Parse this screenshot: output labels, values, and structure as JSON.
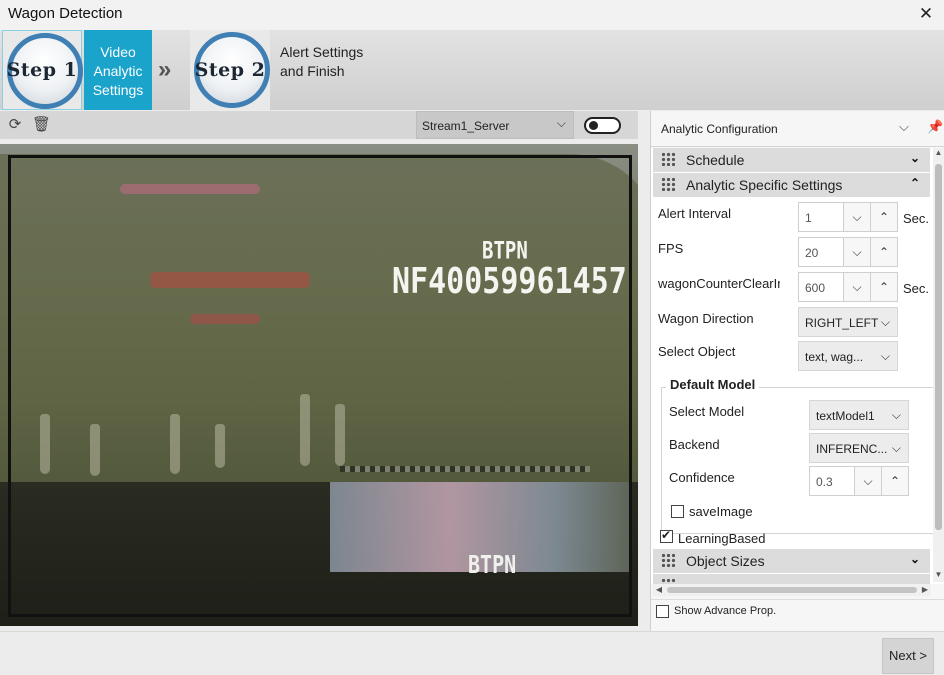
{
  "window": {
    "title": "Wagon Detection",
    "close_glyph": "✕"
  },
  "steps": [
    {
      "badge": "Step 1",
      "label": "Video Analytic Settings",
      "active": true
    },
    {
      "badge": "Step 2",
      "label": "Alert Settings and Finish",
      "active": false
    }
  ],
  "step_separator": "»",
  "video": {
    "toolbar": {
      "refresh_icon": "refresh-icon",
      "delete_icon": "trash-icon"
    },
    "stream": "Stream1_Server",
    "toggle_on": false,
    "frame_text": {
      "plate_small": "BTPN",
      "plate_main": "NF40059961457",
      "plate_lower": "BTPN"
    }
  },
  "panel": {
    "title": "Analytic Configuration",
    "categories": {
      "schedule": {
        "label": "Schedule",
        "expanded": false
      },
      "analytic": {
        "label": "Analytic Specific Settings",
        "expanded": true
      },
      "object_sizes": {
        "label": "Object Sizes",
        "expanded": false
      }
    },
    "props": {
      "alert_interval": {
        "label": "Alert Interval",
        "value": "1",
        "unit": "Sec."
      },
      "fps": {
        "label": "FPS",
        "value": "20"
      },
      "wagon_counter": {
        "label": "wagonCounterClearIr",
        "value": "600",
        "unit": "Sec."
      },
      "wagon_direction": {
        "label": "Wagon Direction",
        "value": "RIGHT_LEFT"
      },
      "select_object": {
        "label": "Select Object",
        "value": "text, wag..."
      }
    },
    "default_model": {
      "title": "Default Model",
      "select_model": {
        "label": "Select Model",
        "value": "textModel1"
      },
      "backend": {
        "label": "Backend",
        "value": "INFERENC..."
      },
      "confidence": {
        "label": "Confidence",
        "value": "0.3"
      },
      "save_image": {
        "label": "saveImage",
        "checked": false
      }
    },
    "learning_based": {
      "label": "LearningBased",
      "checked": true
    },
    "show_advance": {
      "label": "Show Advance Prop.",
      "checked": false
    }
  },
  "footer": {
    "next_label": "Next >"
  }
}
